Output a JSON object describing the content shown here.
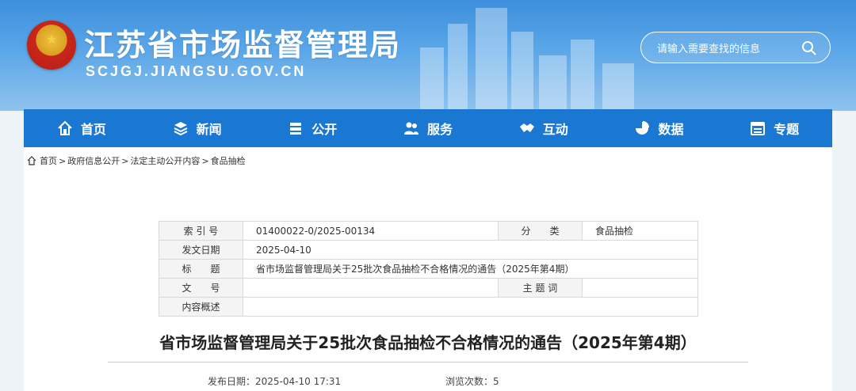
{
  "header": {
    "site_title": "江苏省市场监督管理局",
    "site_domain": "SCJGJ.JIANGSU.GOV.CN",
    "search_placeholder": "请输入需要查找的信息"
  },
  "nav": {
    "items": [
      {
        "label": "首页",
        "icon": "home-icon"
      },
      {
        "label": "新闻",
        "icon": "layers-icon"
      },
      {
        "label": "公开",
        "icon": "stack-icon"
      },
      {
        "label": "服务",
        "icon": "users-icon"
      },
      {
        "label": "互动",
        "icon": "handshake-icon"
      },
      {
        "label": "数据",
        "icon": "pie-chart-icon"
      },
      {
        "label": "专题",
        "icon": "calendar-icon"
      }
    ]
  },
  "breadcrumb": [
    "首页",
    "政府信息公开",
    "法定主动公开内容",
    "食品抽检"
  ],
  "meta": {
    "index_label": "索 引 号",
    "index_value": "01400022-0/2025-00134",
    "category_label": "分　　类",
    "category_value": "食品抽检",
    "date_label": "发文日期",
    "date_value": "2025-04-10",
    "title_label": "标　　题",
    "title_value": "省市场监督管理局关于25批次食品抽检不合格情况的通告（2025年第4期）",
    "docno_label": "文　　号",
    "docno_value": "",
    "keywords_label": "主 题 词",
    "keywords_value": "",
    "summary_label": "内容概述",
    "summary_value": ""
  },
  "article": {
    "title": "省市场监督管理局关于25批次食品抽检不合格情况的通告（2025年第4期）",
    "publish_label": "发布日期：",
    "publish_value": "2025-04-10 17:31",
    "views_label": "浏览次数：",
    "views_value": "5"
  },
  "colors": {
    "nav": "#1a78d2",
    "header": "#3d8fdc"
  }
}
